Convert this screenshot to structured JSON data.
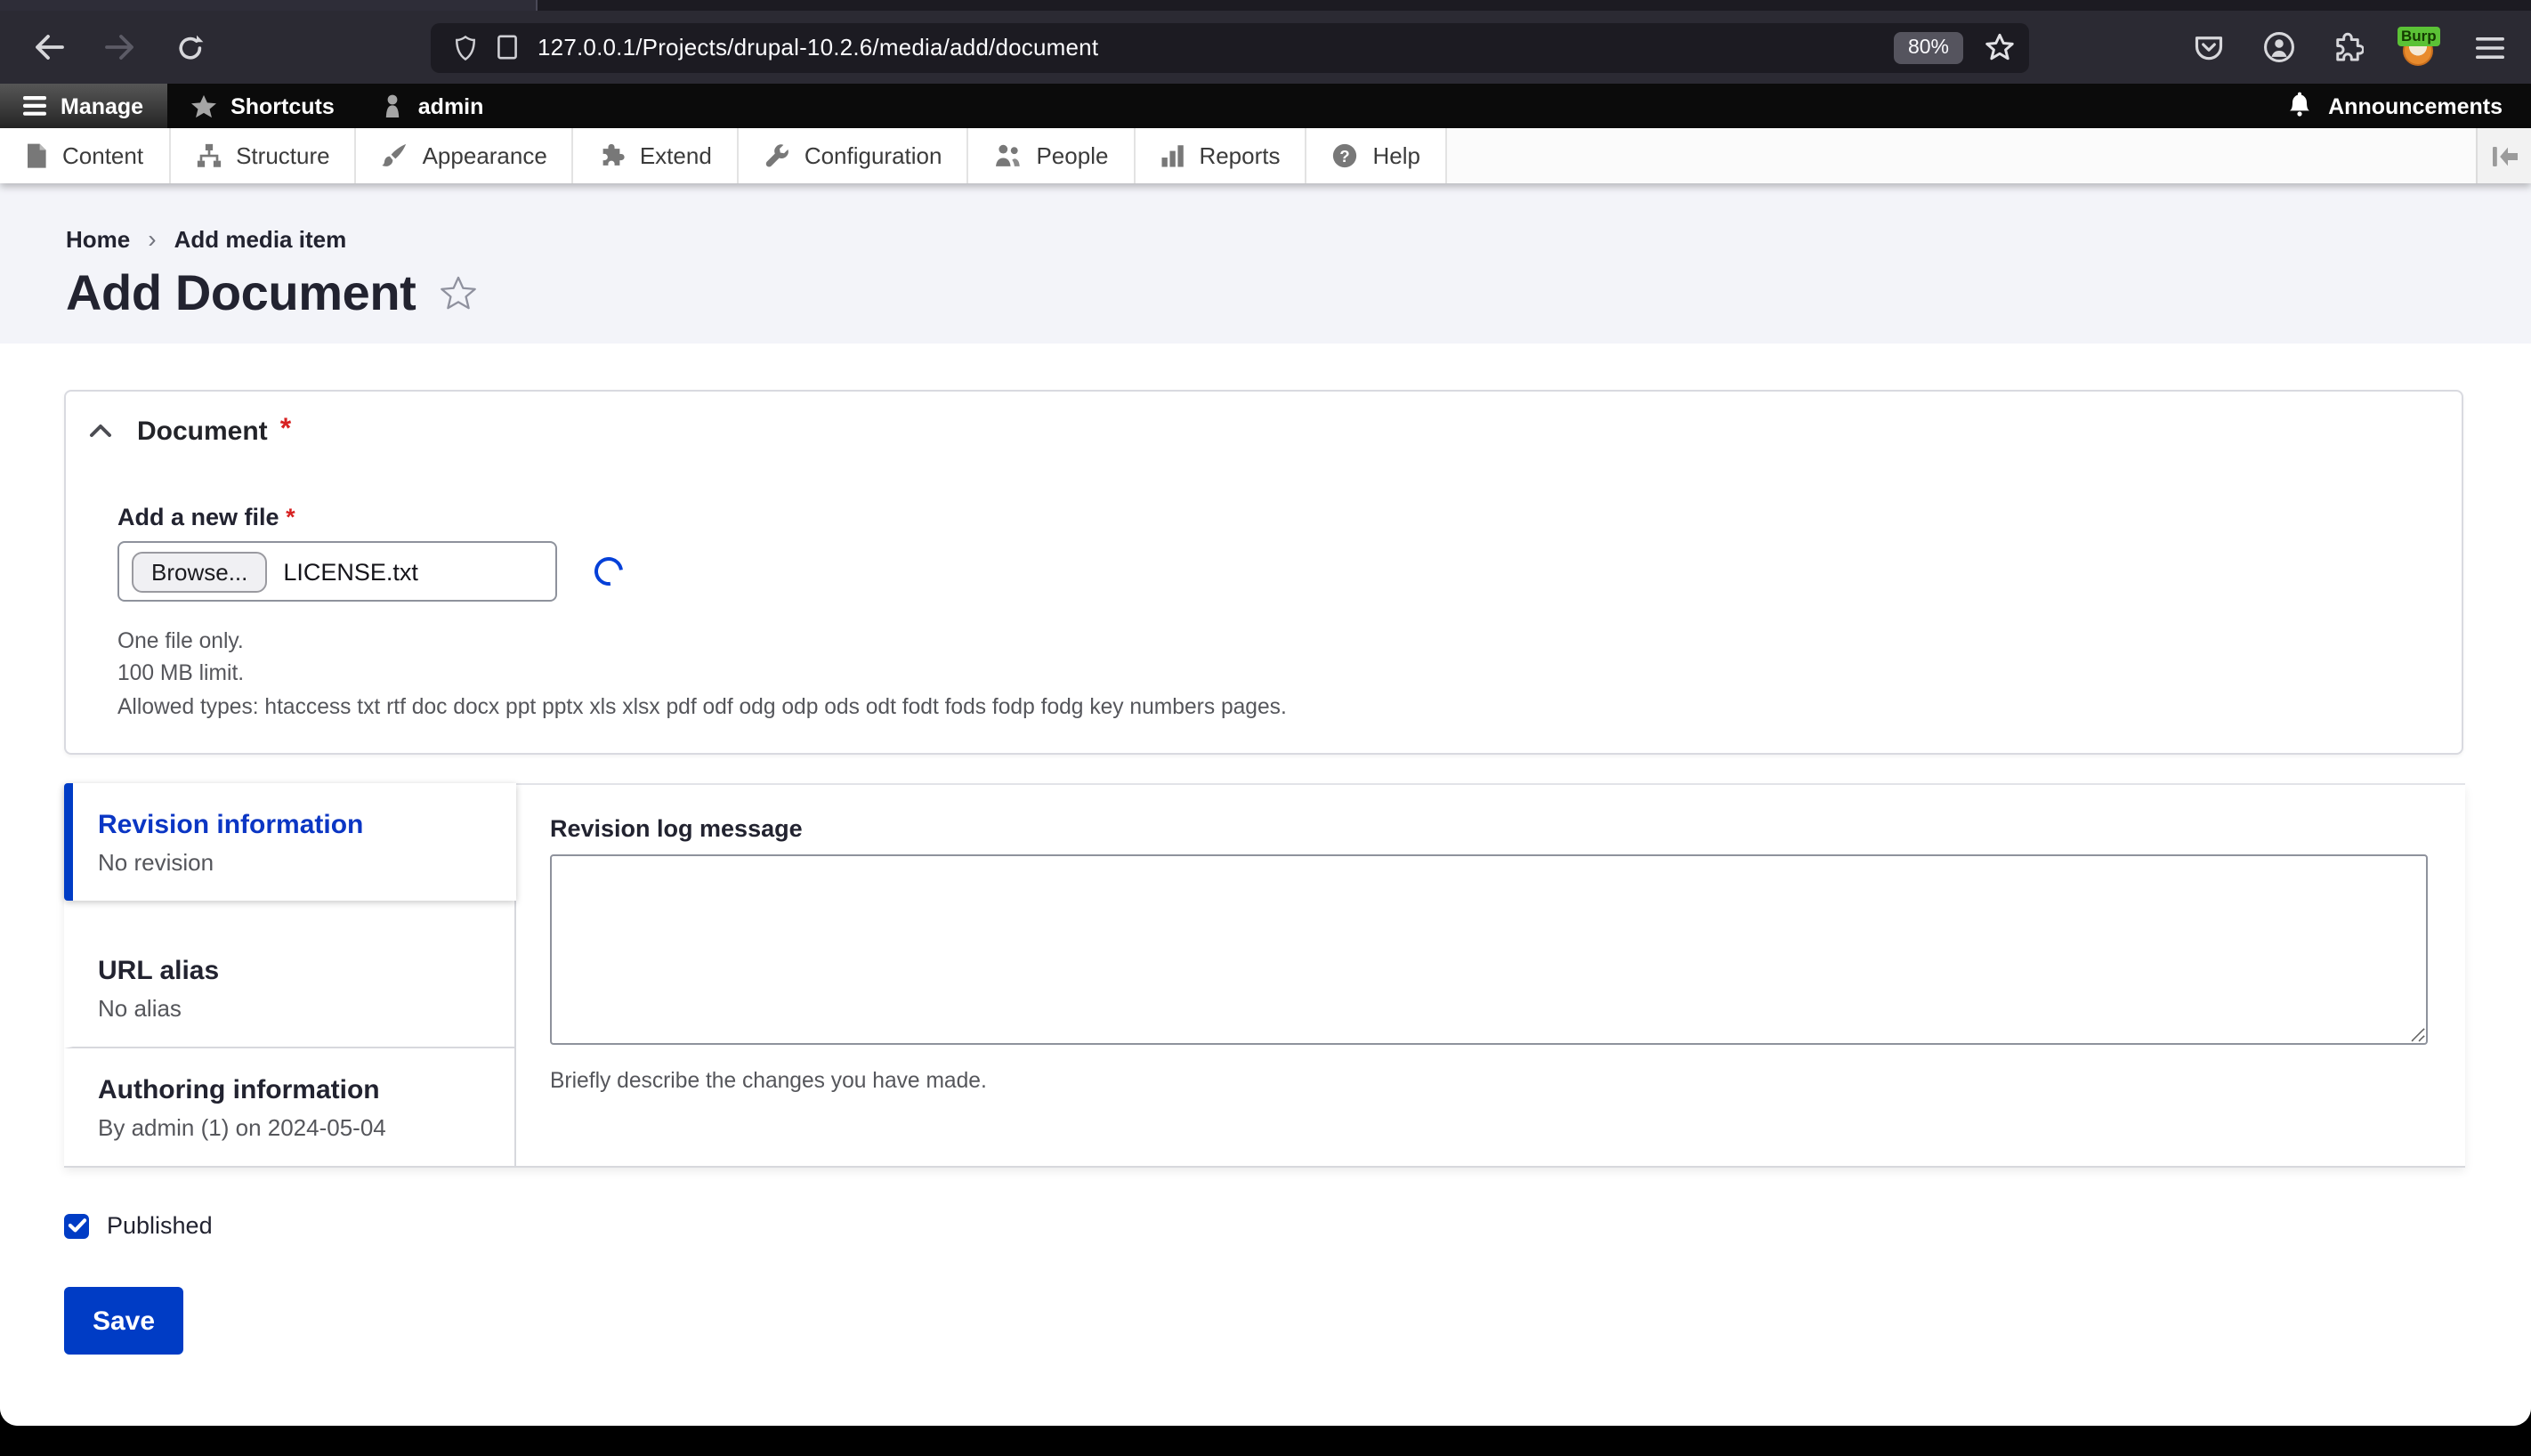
{
  "browser": {
    "url": "127.0.0.1/Projects/drupal-10.2.6/media/add/document",
    "zoom_badge": "80%",
    "extension_badge": "Burp"
  },
  "admin_toolbar": {
    "manage_label": "Manage",
    "shortcuts_label": "Shortcuts",
    "user_label": "admin",
    "announcements_label": "Announcements"
  },
  "admin_menu": {
    "items": [
      "Content",
      "Structure",
      "Appearance",
      "Extend",
      "Configuration",
      "People",
      "Reports",
      "Help"
    ]
  },
  "breadcrumb": {
    "separator": "›",
    "items": [
      "Home",
      "Add media item"
    ]
  },
  "page": {
    "title": "Add Document"
  },
  "document_section": {
    "legend": "Document",
    "required_marker": "*",
    "file_field": {
      "label": "Add a new file",
      "browse_label": "Browse...",
      "file_name": "LICENSE.txt",
      "help": [
        "One file only.",
        "100 MB limit.",
        "Allowed types: htaccess txt rtf doc docx ppt pptx xls xlsx pdf odf odg odp ods odt fodt fods fodp fodg key numbers pages."
      ]
    }
  },
  "vertical_tabs": {
    "tabs": [
      {
        "label": "Revision information",
        "summary": "No revision",
        "active": true
      },
      {
        "label": "URL alias",
        "summary": "No alias",
        "active": false
      },
      {
        "label": "Authoring information",
        "summary": "By admin (1) on 2024-05-04",
        "active": false
      }
    ],
    "pane": {
      "label": "Revision log message",
      "value": "",
      "help": "Briefly describe the changes you have made."
    }
  },
  "publish": {
    "label": "Published",
    "checked": true
  },
  "actions": {
    "save_label": "Save"
  },
  "colors": {
    "primary": "#003cc5",
    "required_red": "#d72222",
    "browser_toolbar_bg": "#2b2a33",
    "urlbar_bg": "#1c1b22",
    "admin_toolbar_bg": "#0b0b0b",
    "header_bg": "#f3f4f9"
  }
}
